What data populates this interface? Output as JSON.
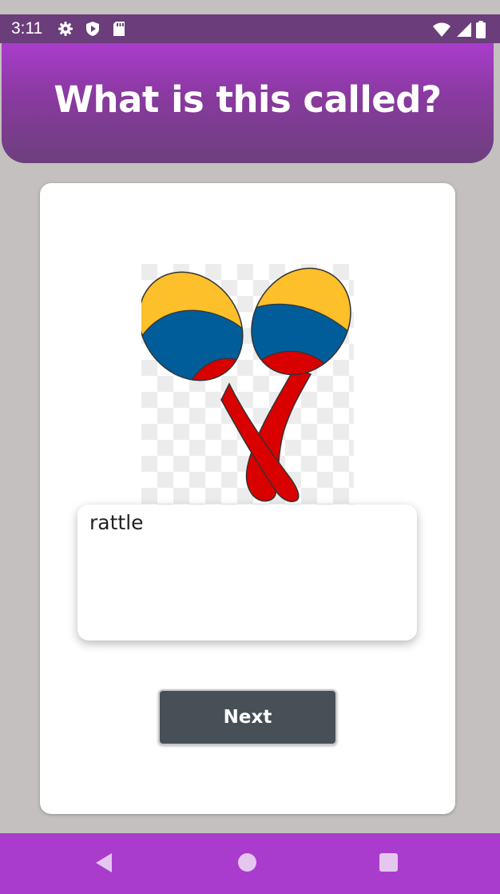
{
  "status_bar": {
    "time": "3:11",
    "icons_left": [
      "gear-icon",
      "shield-play-icon",
      "sd-card-icon"
    ],
    "icons_right": [
      "wifi-icon",
      "signal-icon",
      "battery-icon"
    ]
  },
  "header": {
    "title": "What is this called?"
  },
  "quiz": {
    "image_subject": "maracas-image",
    "answer_value": "rattle",
    "next_label": "Next"
  },
  "nav_bar": {
    "icons": [
      "back-icon",
      "home-icon",
      "recents-icon"
    ]
  },
  "colors": {
    "header_top": "#a93ccc",
    "header_bottom": "#6d3f7d",
    "background": "#c3c0bf",
    "button": "#474f57",
    "maraca_yellow": "#fdbf2a",
    "maraca_blue": "#005d99",
    "maraca_red": "#d90000"
  }
}
